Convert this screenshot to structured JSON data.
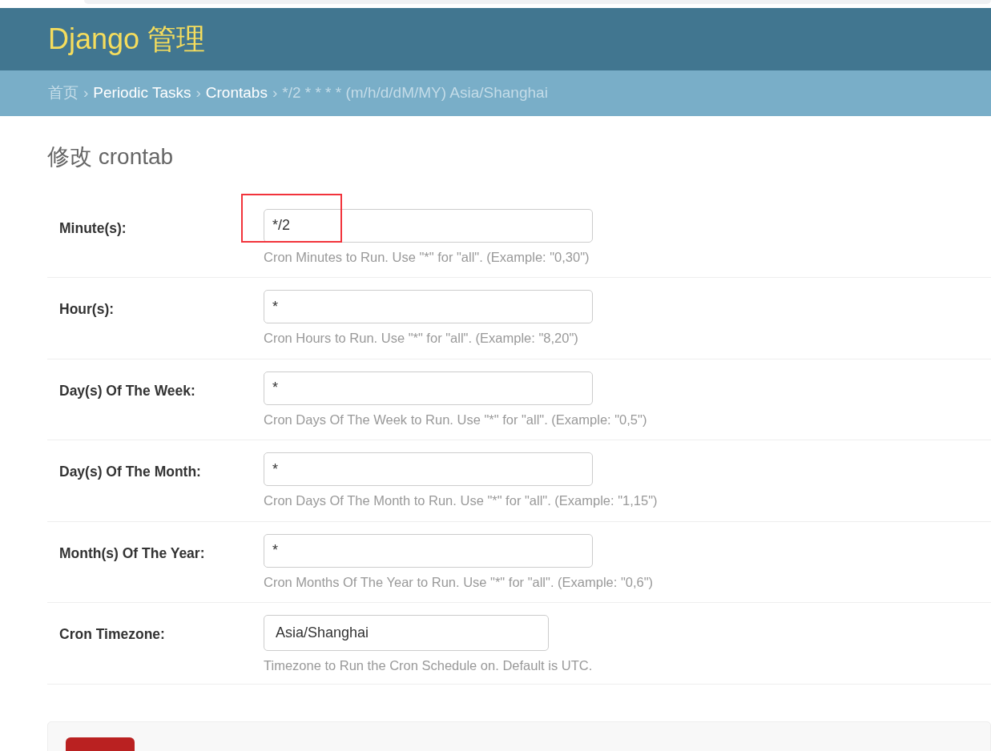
{
  "header": {
    "site_name": "Django 管理"
  },
  "breadcrumbs": [
    {
      "label": "首页",
      "kind": "home"
    },
    {
      "separator_before": "›",
      "label": "Periodic Tasks",
      "kind": "link"
    },
    {
      "separator_before": "›",
      "label": "Crontabs",
      "kind": "link"
    },
    {
      "separator_before": "›",
      "label": "*/2 * * * * (m/h/d/dM/MY) Asia/Shanghai",
      "kind": "current"
    }
  ],
  "page_title": "修改 crontab",
  "fields": [
    {
      "label": "Minute(s):",
      "kind": "text",
      "value": "*/2",
      "help": "Cron Minutes to Run. Use \"*\" for \"all\". (Example: \"0,30\")",
      "highlighted": true
    },
    {
      "label": "Hour(s):",
      "kind": "text",
      "value": "*",
      "help": "Cron Hours to Run. Use \"*\" for \"all\". (Example: \"8,20\")",
      "highlighted": false
    },
    {
      "label": "Day(s) Of The Week:",
      "kind": "text",
      "value": "*",
      "help": "Cron Days Of The Week to Run. Use \"*\" for \"all\". (Example: \"0,5\")",
      "highlighted": false
    },
    {
      "label": "Day(s) Of The Month:",
      "kind": "text",
      "value": "*",
      "help": "Cron Days Of The Month to Run. Use \"*\" for \"all\". (Example: \"1,15\")",
      "highlighted": false
    },
    {
      "label": "Month(s) Of The Year:",
      "kind": "text",
      "value": "*",
      "help": "Cron Months Of The Year to Run. Use \"*\" for \"all\". (Example: \"0,6\")",
      "highlighted": false
    },
    {
      "label": "Cron Timezone:",
      "kind": "select",
      "value": "Asia/Shanghai",
      "help": "Timezone to Run the Cron Schedule on. Default is UTC.",
      "highlighted": false
    }
  ]
}
